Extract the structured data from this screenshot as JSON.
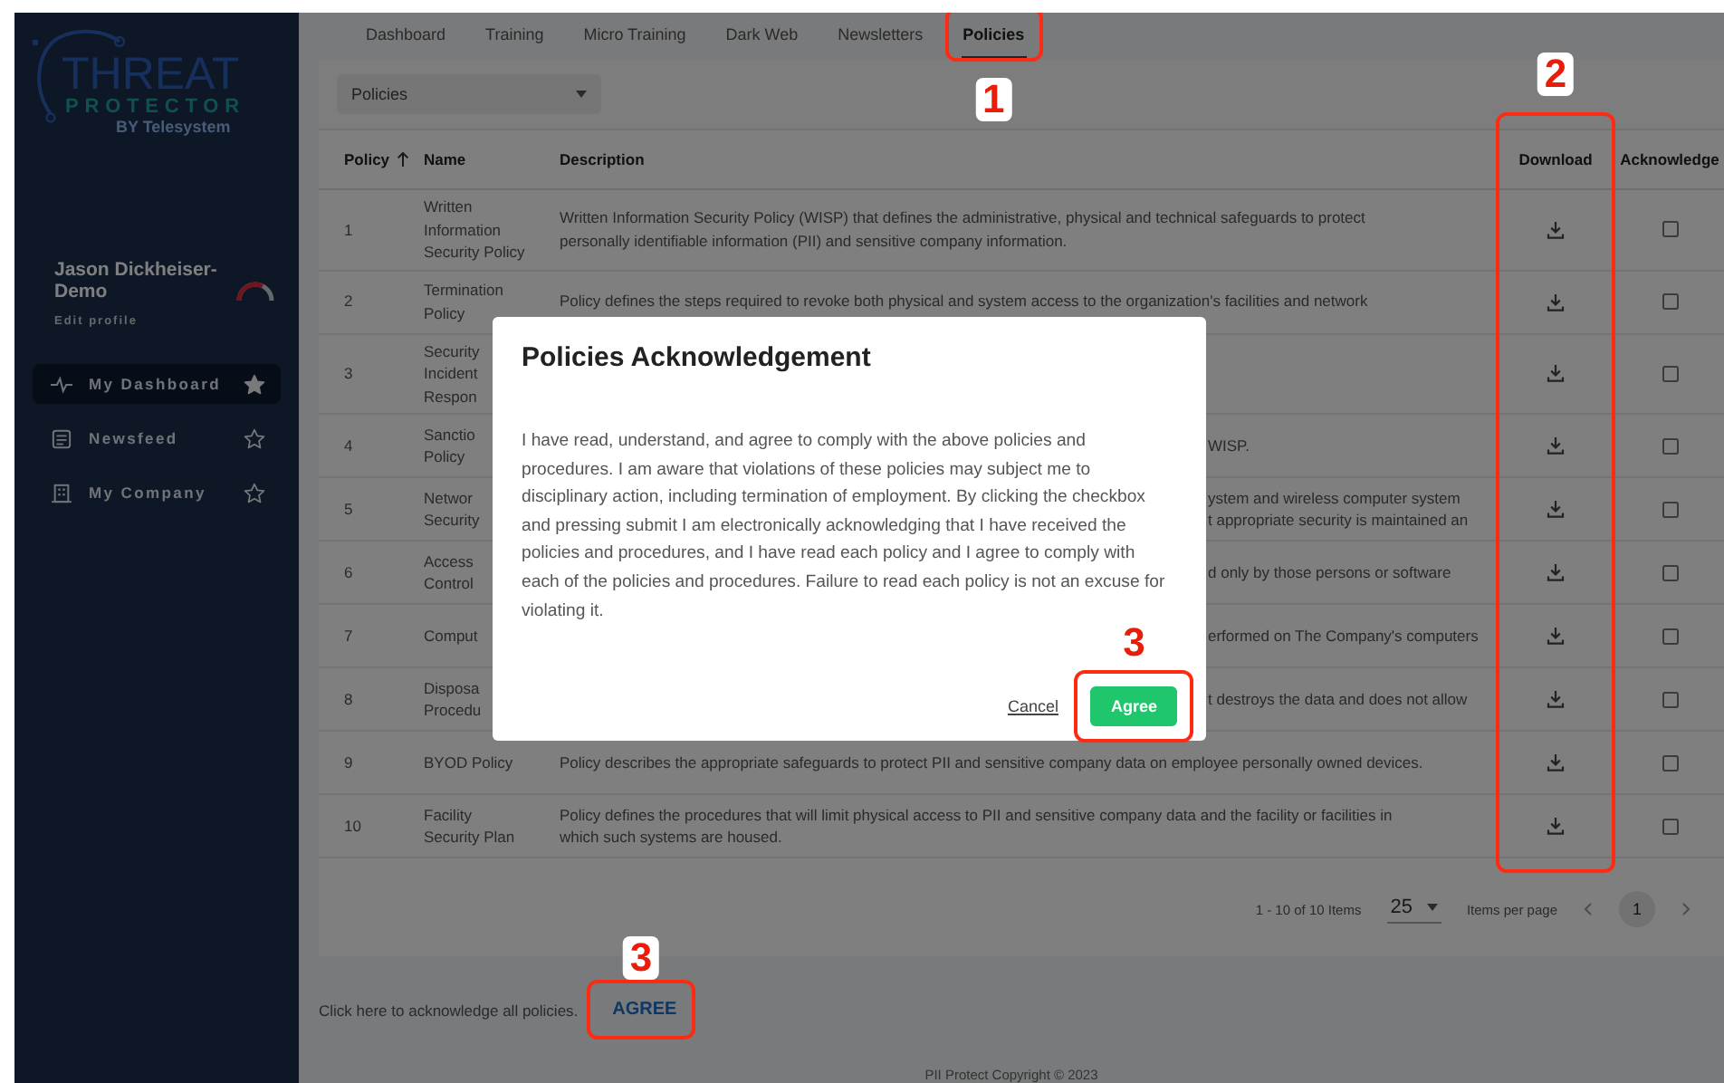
{
  "sidebar": {
    "logo": {
      "line1": "THREAT",
      "line2": "PROTECTOR",
      "byline": "BY Telesystem"
    },
    "user": {
      "name": "Jason Dickheiser-Demo",
      "edit_link": "Edit profile"
    },
    "nav": [
      {
        "label": "My Dashboard",
        "selected": true,
        "favorite": true
      },
      {
        "label": "Newsfeed",
        "selected": false,
        "favorite": false
      },
      {
        "label": "My Company",
        "selected": false,
        "favorite": false
      }
    ]
  },
  "tabs": [
    {
      "label": "Dashboard",
      "selected": false
    },
    {
      "label": "Training",
      "selected": false
    },
    {
      "label": "Micro Training",
      "selected": false
    },
    {
      "label": "Dark Web",
      "selected": false
    },
    {
      "label": "Newsletters",
      "selected": false
    },
    {
      "label": "Policies",
      "selected": true,
      "annotation": {
        "label": "1"
      }
    }
  ],
  "filter": {
    "value": "Policies"
  },
  "table": {
    "columns": [
      {
        "label": "Policy",
        "sorted_ascending": true
      },
      {
        "label": "Name"
      },
      {
        "label": "Description"
      },
      {
        "label": "Download",
        "annotation": {
          "label": "2"
        }
      },
      {
        "label": "Acknowledge"
      }
    ],
    "rows": [
      {
        "number": "1",
        "name_lines": [
          "Written",
          "Information",
          "Security Policy"
        ],
        "covered": false,
        "description_lines": [
          "Written Information Security Policy (WISP) that defines the administrative, physical and technical safeguards to protect",
          "personally identifiable information (PII) and sensitive company information."
        ],
        "acknowledged": false
      },
      {
        "number": "2",
        "name_lines": [
          "Termination",
          "Policy"
        ],
        "covered": false,
        "description_lines": [
          "Policy defines the steps required to revoke both physical and system access to the organization's facilities and network"
        ],
        "acknowledged": false
      },
      {
        "number": "3",
        "name_lines": [
          "Security",
          "Incident",
          "Respon"
        ],
        "acknowledged": false
      },
      {
        "number": "4",
        "name_lines": [
          "Sanctio",
          "Policy"
        ],
        "covered": true,
        "description_lines": [
          "WISP."
        ],
        "acknowledged": false
      },
      {
        "number": "5",
        "name_lines": [
          "Networ",
          "Security"
        ],
        "covered": true,
        "description_lines": [
          "ystem and wireless computer system",
          "t appropriate security is maintained an"
        ],
        "acknowledged": false
      },
      {
        "number": "6",
        "name_lines": [
          "Access",
          "Control"
        ],
        "covered": true,
        "description_lines": [
          "d only by those persons or software"
        ],
        "acknowledged": false
      },
      {
        "number": "7",
        "name_lines": [
          "Comput"
        ],
        "covered": true,
        "description_lines": [
          "erformed on The Company's computers"
        ],
        "acknowledged": false
      },
      {
        "number": "8",
        "name_lines": [
          "Disposa",
          "Procedu"
        ],
        "covered": true,
        "description_lines": [
          "t destroys the data and does not allow"
        ],
        "acknowledged": false
      },
      {
        "number": "9",
        "name_lines": [
          "BYOD Policy"
        ],
        "covered": false,
        "description_lines": [
          "Policy describes the appropriate safeguards to protect PII and sensitive company data on employee personally owned devices."
        ],
        "acknowledged": false
      },
      {
        "number": "10",
        "name_lines": [
          "Facility",
          "Security Plan"
        ],
        "covered": false,
        "description_lines": [
          "Policy defines the procedures that will limit physical access to PII and sensitive company data and the facility or facilities in",
          "which such systems are housed."
        ],
        "acknowledged": false
      }
    ]
  },
  "pagination": {
    "range": "1 - 10 of 10 Items",
    "page_size": "25",
    "page_size_label": "Items per page",
    "pages": [
      {
        "label": "1",
        "selected": true
      }
    ]
  },
  "footer": {
    "text": "Click here to acknowledge all policies.",
    "link": "AGREE",
    "annotation": {
      "label": "3"
    },
    "copyright": "PII Protect Copyright © 2023"
  },
  "dialog": {
    "title": "Policies Acknowledgement",
    "body": "I have read, understand, and agree to comply with the above policies and procedures. I am aware that violations of these policies may subject me to disciplinary action, including termination of employment. By clicking the checkbox and pressing submit I am electronically acknowledging that I have received the policies and procedures, and I have read each policy and I agree to comply with each of the policies and procedures. Failure to read each policy is not an excuse for violating it.",
    "buttons": [
      {
        "label": "Cancel",
        "kind": "link"
      },
      {
        "label": "Agree",
        "kind": "primary",
        "annotation": {
          "label": "3"
        }
      }
    ]
  }
}
